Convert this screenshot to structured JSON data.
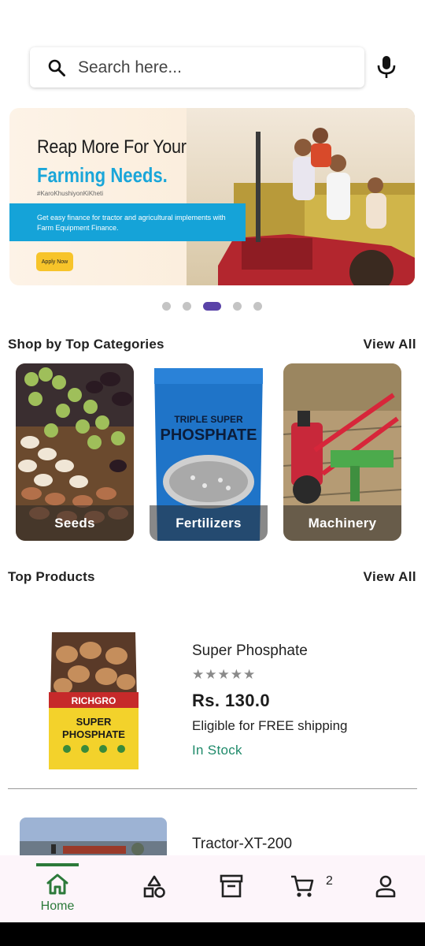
{
  "search": {
    "placeholder": "Search here..."
  },
  "banner": {
    "headline_line1": "Reap More For Your",
    "headline_line2": "Farming Needs.",
    "hashtag": "#KaroKhushiyonKiKheti",
    "strip_text": "Get easy finance for tractor and agricultural implements with Farm Equipment Finance.",
    "cta_label": "Apply Now"
  },
  "carousel": {
    "dot_count": 5,
    "active_index": 2
  },
  "categories_section": {
    "title": "Shop by Top Categories",
    "view_all_label": "View All",
    "items": [
      {
        "label": "Seeds"
      },
      {
        "label": "Fertilizers",
        "package_text": "TRIPLE SUPER PHOSPHATE"
      },
      {
        "label": "Machinery"
      }
    ]
  },
  "products_section": {
    "title": "Top Products",
    "view_all_label": "View All",
    "items": [
      {
        "name": "Super Phosphate",
        "rating_stars": "★★★★★",
        "rating_value": 0,
        "price": "Rs. 130.0",
        "shipping": "Eligible for FREE shipping",
        "stock": "In Stock",
        "package_brand": "RICHGRO",
        "package_title": "SUPER PHOSPHATE"
      },
      {
        "name": "Tractor-XT-200"
      }
    ]
  },
  "bottom_nav": {
    "items": [
      {
        "label": "Home",
        "icon": "home-icon",
        "active": true
      },
      {
        "label": "",
        "icon": "categories-icon",
        "active": false
      },
      {
        "label": "",
        "icon": "orders-archive-icon",
        "active": false
      },
      {
        "label": "",
        "icon": "cart-icon",
        "active": false
      },
      {
        "label": "",
        "icon": "profile-icon",
        "active": false
      }
    ],
    "cart_count": "2"
  },
  "colors": {
    "accent_green": "#2c7a3a",
    "carousel_active": "#5a43a8",
    "banner_blue": "#15a3d8",
    "in_stock": "#1f8a6a"
  }
}
